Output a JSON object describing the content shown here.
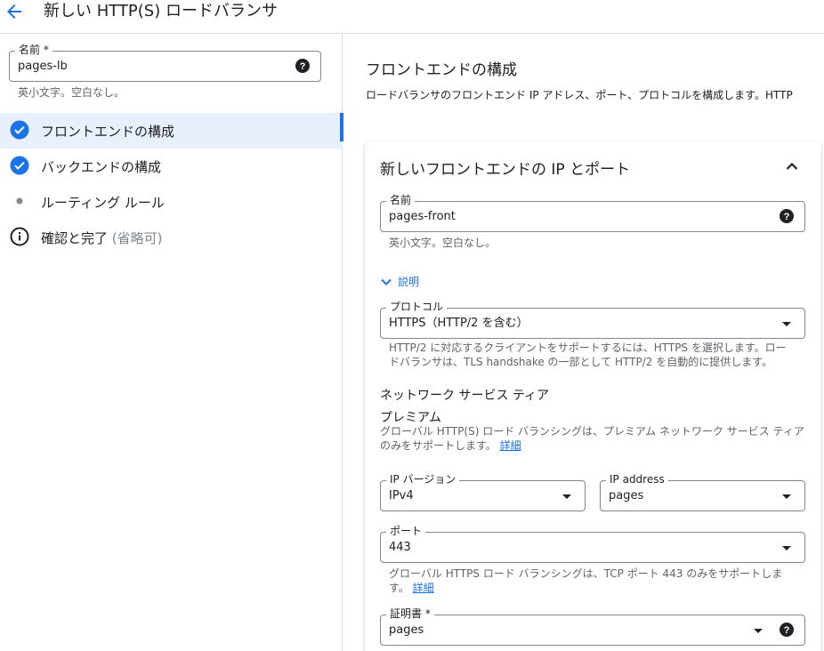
{
  "header": {
    "title": "新しい HTTP(S) ロードバランサ",
    "back_icon": "arrow-back-icon"
  },
  "colors": {
    "accent": "#1a73e8",
    "active_step_bg": "#e8f0fe",
    "divider": "#dadce0"
  },
  "left": {
    "name_field": {
      "label": "名前 *",
      "value": "pages-lb",
      "hint": "英小文字。空白なし。"
    },
    "steps": [
      {
        "label": "フロントエンドの構成",
        "icon": "check-circle-icon",
        "active": true
      },
      {
        "label": "バックエンドの構成",
        "icon": "check-circle-icon",
        "active": false
      },
      {
        "label": "ルーティング ルール",
        "icon": "dot-icon",
        "active": false
      },
      {
        "label": "確認と完了",
        "optional": "(省略可)",
        "icon": "info-icon",
        "active": false
      }
    ]
  },
  "right": {
    "title": "フロントエンドの構成",
    "description": "ロードバランサのフロントエンド IP アドレス、ポート、プロトコルを構成します。HTTP",
    "card": {
      "title": "新しいフロントエンドの IP とポート",
      "name": {
        "label": "名前",
        "value": "pages-front",
        "hint": "英小文字。空白なし。"
      },
      "description_toggle": "説明",
      "protocol": {
        "label": "プロトコル",
        "value": "HTTPS（HTTP/2 を含む）",
        "help_line1": "HTTP/2 に対応するクライアントをサポートするには、HTTPS を選択します。ロー",
        "help_line2": "ドバランサは、TLS handshake の一部として HTTP/2 を自動的に提供します。"
      },
      "network_tier": {
        "label": "ネットワーク サービス ティア",
        "value": "プレミアム",
        "help_line1": "グローバル HTTP(S) ロード バランシングは、プレミアム ネットワーク サービス ティア",
        "help_line2": "のみをサポートします。",
        "link": "詳細"
      },
      "ip_version": {
        "label": "IP バージョン",
        "value": "IPv4"
      },
      "ip_address": {
        "label": "IP address",
        "value": "pages"
      },
      "port": {
        "label": "ポート",
        "value": "443",
        "help_line1": "グローバル HTTPS ロード バランシングは、TCP ポート 443 のみをサポートしま",
        "help_line2": "す。",
        "link": "詳細"
      },
      "certificate": {
        "label": "証明書 *",
        "value": "pages"
      }
    }
  }
}
